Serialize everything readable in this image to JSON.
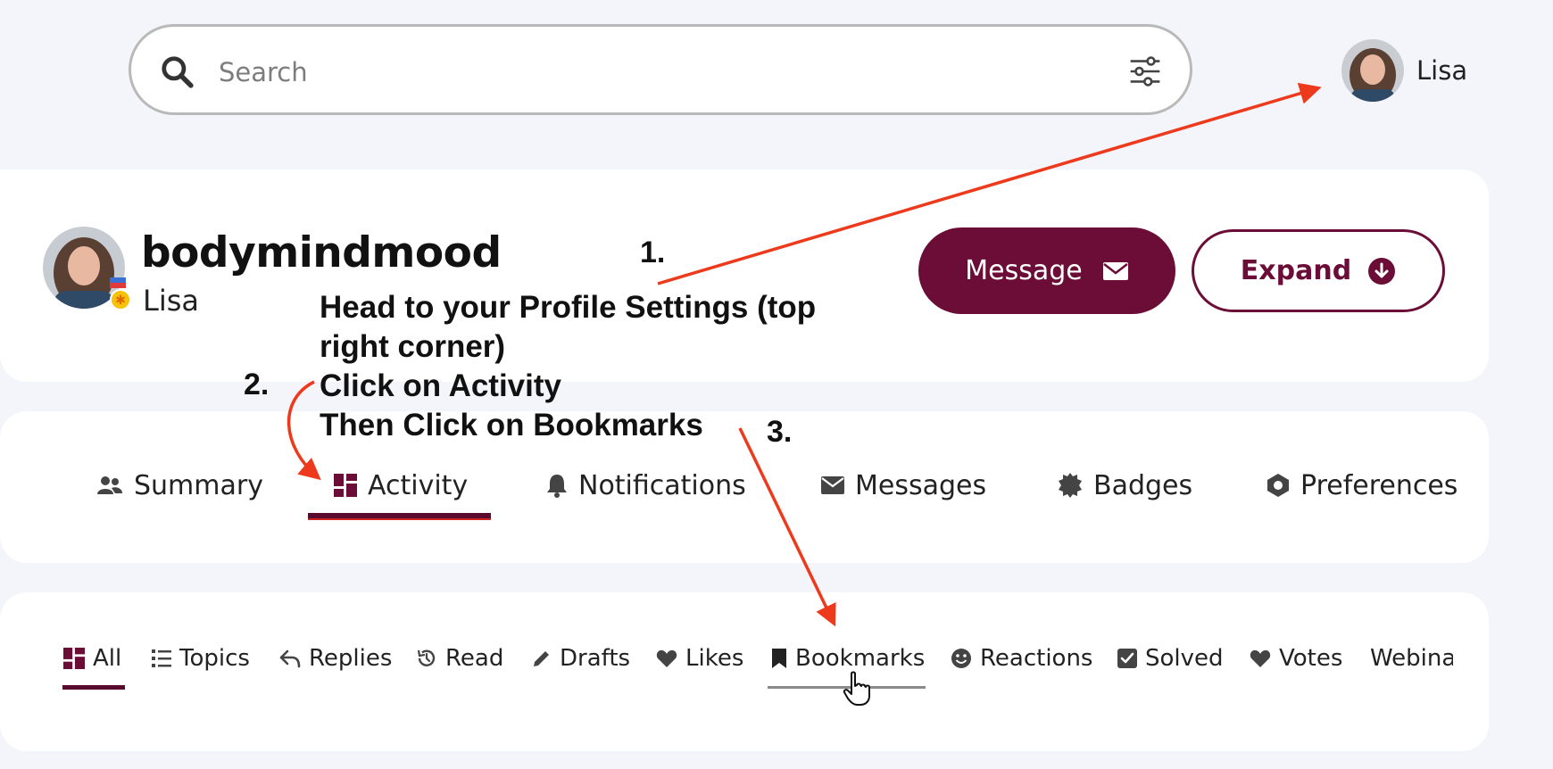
{
  "search": {
    "placeholder": "Search"
  },
  "header_user": {
    "name": "Lisa"
  },
  "profile": {
    "username": "bodymindmood",
    "full_name": "Lisa",
    "message_label": "Message",
    "expand_label": "Expand"
  },
  "tabs": [
    {
      "label": "Summary",
      "icon": "users-icon"
    },
    {
      "label": "Activity",
      "icon": "dashboard-icon",
      "active": true
    },
    {
      "label": "Notifications",
      "icon": "bell-icon"
    },
    {
      "label": "Messages",
      "icon": "envelope-icon"
    },
    {
      "label": "Badges",
      "icon": "badge-icon"
    },
    {
      "label": "Preferences",
      "icon": "hexagon-icon"
    }
  ],
  "sub_tabs": [
    {
      "label": "All",
      "icon": "dashboard-icon",
      "active": true
    },
    {
      "label": "Topics",
      "icon": "list-icon"
    },
    {
      "label": "Replies",
      "icon": "reply-icon"
    },
    {
      "label": "Read",
      "icon": "history-icon"
    },
    {
      "label": "Drafts",
      "icon": "pencil-icon"
    },
    {
      "label": "Likes",
      "icon": "heart-icon"
    },
    {
      "label": "Bookmarks",
      "icon": "bookmark-icon",
      "hovered": true
    },
    {
      "label": "Reactions",
      "icon": "smile-icon"
    },
    {
      "label": "Solved",
      "icon": "check-square-icon"
    },
    {
      "label": "Votes",
      "icon": "heart-icon"
    },
    {
      "label": "Webinars",
      "icon": ""
    }
  ],
  "annotations": {
    "step1": "1.",
    "step2": "2.",
    "step3": "3.",
    "line1": "Head to your Profile Settings (top right corner)",
    "line2": "Click on Activity",
    "line3": "Then Click on Bookmarks"
  },
  "colors": {
    "brand": "#6b0d36",
    "background": "#f4f4fb",
    "arrow": "#ee3a1c"
  }
}
